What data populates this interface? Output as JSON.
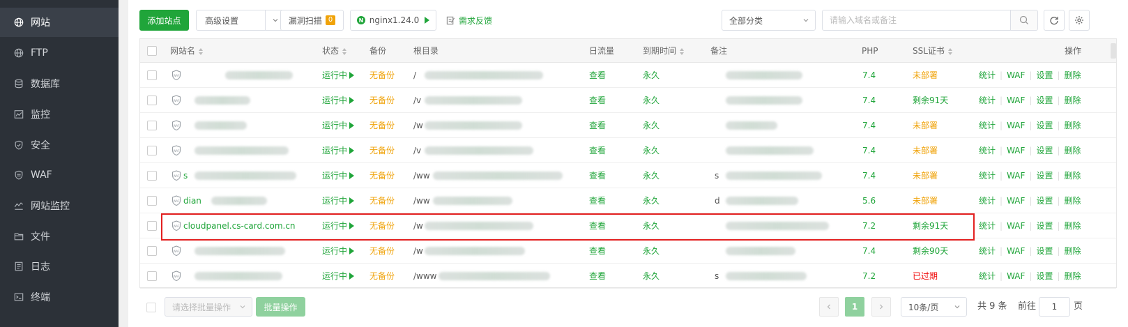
{
  "sidebar": {
    "items": [
      {
        "label": "网站",
        "icon": "globe-icon",
        "active": true
      },
      {
        "label": "FTP",
        "icon": "ftp-globe-icon",
        "active": false
      },
      {
        "label": "数据库",
        "icon": "database-icon",
        "active": false
      },
      {
        "label": "监控",
        "icon": "monitor-icon",
        "active": false
      },
      {
        "label": "安全",
        "icon": "shield-icon",
        "active": false
      },
      {
        "label": "WAF",
        "icon": "waf-shield-icon",
        "active": false
      },
      {
        "label": "网站监控",
        "icon": "chart-icon",
        "active": false
      },
      {
        "label": "文件",
        "icon": "folder-icon",
        "active": false
      },
      {
        "label": "日志",
        "icon": "log-icon",
        "active": false
      },
      {
        "label": "终端",
        "icon": "terminal-icon",
        "active": false
      }
    ]
  },
  "toolbar": {
    "add_site": "添加站点",
    "advanced": "高级设置",
    "vuln_scan": "漏洞扫描",
    "vuln_count": "0",
    "nginx": "nginx1.24.0",
    "feedback": "需求反馈",
    "category": "全部分类",
    "search_placeholder": "请输入域名或备注"
  },
  "table": {
    "headers": {
      "name": "网站名",
      "status": "状态",
      "backup": "备份",
      "root": "根目录",
      "traffic": "日流量",
      "expire": "到期时间",
      "remark": "备注",
      "php": "PHP",
      "ssl": "SSL证书",
      "ops": "操作"
    },
    "rows": [
      {
        "name": "",
        "status": "运行中",
        "backup": "无备份",
        "root": "/",
        "traffic": "查看",
        "expire": "永久",
        "remark": "",
        "php": "7.4",
        "ssl": "未部署",
        "ssl_color": "orange"
      },
      {
        "name": "",
        "status": "运行中",
        "backup": "无备份",
        "root": "/v",
        "traffic": "查看",
        "expire": "永久",
        "remark": "",
        "php": "7.4",
        "ssl": "剩余91天",
        "ssl_color": "green"
      },
      {
        "name": "",
        "status": "运行中",
        "backup": "无备份",
        "root": "/w",
        "traffic": "查看",
        "expire": "永久",
        "remark": "",
        "php": "7.4",
        "ssl": "未部署",
        "ssl_color": "orange"
      },
      {
        "name": "",
        "status": "运行中",
        "backup": "无备份",
        "root": "/v",
        "traffic": "查看",
        "expire": "永久",
        "remark": "",
        "php": "7.4",
        "ssl": "未部署",
        "ssl_color": "orange"
      },
      {
        "name": "s",
        "status": "运行中",
        "backup": "无备份",
        "root": "/ww",
        "traffic": "查看",
        "expire": "永久",
        "remark": "s",
        "php": "7.4",
        "ssl": "未部署",
        "ssl_color": "orange"
      },
      {
        "name": "dian",
        "status": "运行中",
        "backup": "无备份",
        "root": "/ww",
        "traffic": "查看",
        "expire": "永久",
        "remark": "d",
        "php": "5.6",
        "ssl": "未部署",
        "ssl_color": "orange"
      },
      {
        "name": "cloudpanel.cs-card.com.cn",
        "status": "运行中",
        "backup": "无备份",
        "root": "/w",
        "traffic": "查看",
        "expire": "永久",
        "remark": "",
        "php": "7.2",
        "ssl": "剩余91天",
        "ssl_color": "green"
      },
      {
        "name": "",
        "status": "运行中",
        "backup": "无备份",
        "root": "/w",
        "traffic": "查看",
        "expire": "永久",
        "remark": "",
        "php": "7.4",
        "ssl": "剩余90天",
        "ssl_color": "green"
      },
      {
        "name": "",
        "status": "运行中",
        "backup": "无备份",
        "root": "/www",
        "traffic": "查看",
        "expire": "永久",
        "remark": "s",
        "php": "7.2",
        "ssl": "已过期",
        "ssl_color": "red"
      }
    ],
    "ops": [
      "统计",
      "WAF",
      "设置",
      "删除"
    ],
    "waf_badge": "WAF"
  },
  "footer": {
    "batch_select_placeholder": "请选择批量操作",
    "batch_btn": "批量操作",
    "current_page": "1",
    "page_size": "10条/页",
    "total": "共 9 条",
    "goto_label": "前往",
    "goto_value": "1",
    "page_unit": "页"
  },
  "colors": {
    "accent": "#20a53a",
    "warning": "#f0a30a",
    "danger": "#ef0808",
    "sidebar_bg": "#2c3138",
    "highlight": "#e32020"
  }
}
